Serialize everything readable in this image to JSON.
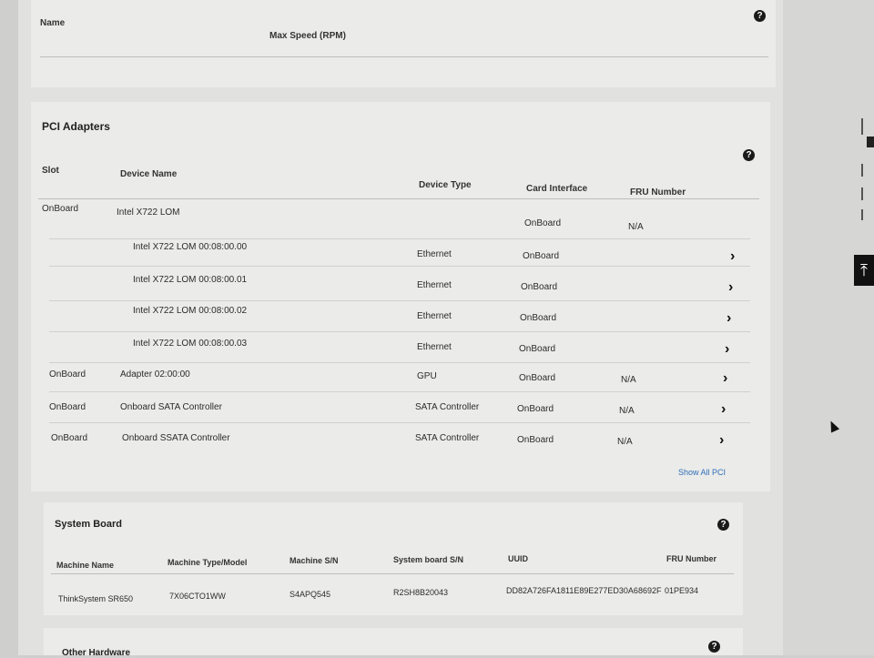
{
  "fans": {
    "col_name": "Name",
    "col_max_speed": "Max Speed (RPM)"
  },
  "pci": {
    "title": "PCI Adapters",
    "headers": {
      "slot": "Slot",
      "device_name": "Device Name",
      "device_type": "Device Type",
      "card_interface": "Card Interface",
      "fru_number": "FRU Number"
    },
    "rows": [
      {
        "slot": "OnBoard",
        "name": "Intel X722 LOM",
        "type": "",
        "interface": "OnBoard",
        "fru": "N/A"
      },
      {
        "slot": "",
        "name": "Intel X722 LOM 00:08:00.00",
        "type": "Ethernet",
        "interface": "OnBoard",
        "fru": ""
      },
      {
        "slot": "",
        "name": "Intel X722 LOM 00:08:00.01",
        "type": "Ethernet",
        "interface": "OnBoard",
        "fru": ""
      },
      {
        "slot": "",
        "name": "Intel X722 LOM 00:08:00.02",
        "type": "Ethernet",
        "interface": "OnBoard",
        "fru": ""
      },
      {
        "slot": "",
        "name": "Intel X722 LOM 00:08:00.03",
        "type": "Ethernet",
        "interface": "OnBoard",
        "fru": ""
      },
      {
        "slot": "OnBoard",
        "name": "Adapter 02:00:00",
        "type": "GPU",
        "interface": "OnBoard",
        "fru": "N/A"
      },
      {
        "slot": "OnBoard",
        "name": "Onboard SATA Controller",
        "type": "SATA Controller",
        "interface": "OnBoard",
        "fru": "N/A"
      },
      {
        "slot": "OnBoard",
        "name": "Onboard SSATA Controller",
        "type": "SATA Controller",
        "interface": "OnBoard",
        "fru": "N/A"
      }
    ],
    "show_all": "Show All PCI"
  },
  "system_board": {
    "title": "System Board",
    "headers": {
      "machine_name": "Machine Name",
      "machine_type": "Machine Type/Model",
      "machine_sn": "Machine S/N",
      "board_sn": "System board S/N",
      "uuid": "UUID",
      "fru": "FRU Number"
    },
    "values": {
      "machine_name": "ThinkSystem SR650",
      "machine_type": "7X06CTO1WW",
      "machine_sn": "S4APQ545",
      "board_sn": "R2SH8B20043",
      "uuid": "DD82A726FA1811E89E277ED30A68692F",
      "fru": "01PE934"
    }
  },
  "other_hardware": {
    "title": "Other Hardware"
  },
  "icons": {
    "help": "?",
    "chevron": "›",
    "back_to_top": "⤒"
  }
}
